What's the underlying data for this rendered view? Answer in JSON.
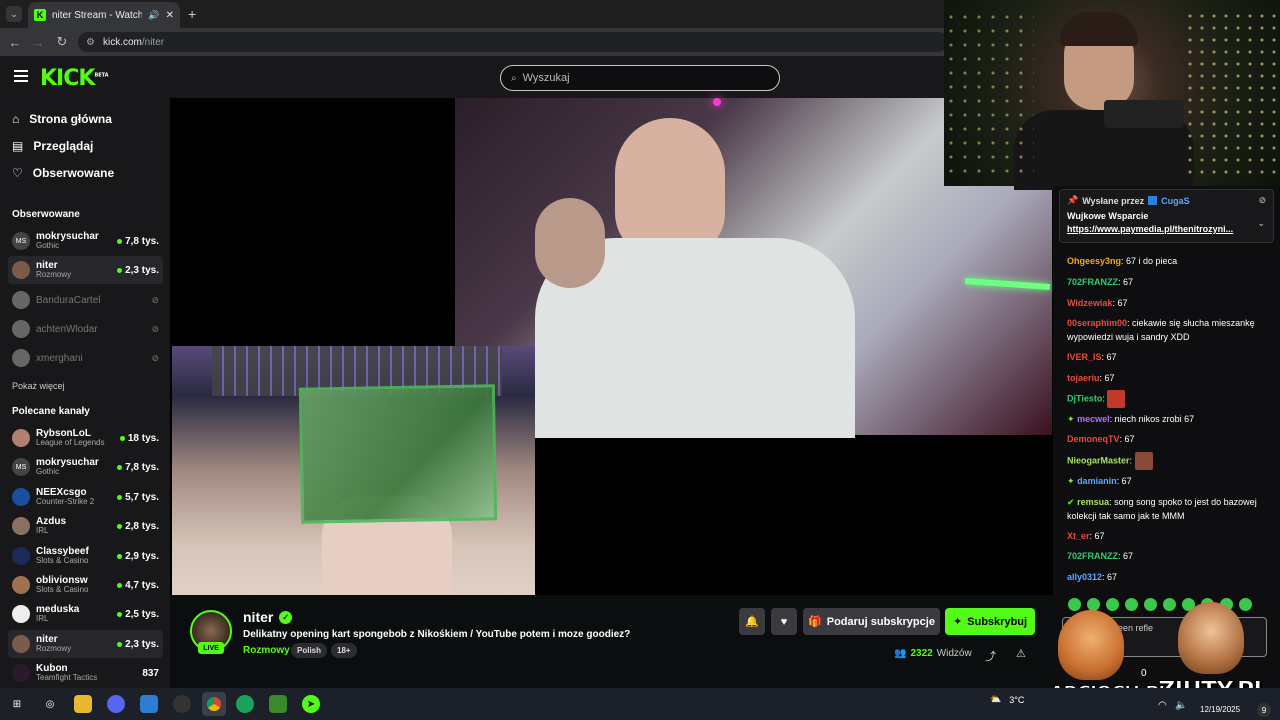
{
  "browser": {
    "tab_title": "niter Stream - Watch Live on Kick",
    "url": "kick.com/niter",
    "url_host": "kick.com",
    "url_path": "/niter"
  },
  "header": {
    "logo": "KICK",
    "logo_beta": "BETA",
    "search_placeholder": "Wyszukaj"
  },
  "sidebar": {
    "nav": [
      {
        "label": "Strona główna",
        "icon": "home-icon"
      },
      {
        "label": "Przeglądaj",
        "icon": "browse-icon"
      },
      {
        "label": "Obserwowane",
        "icon": "heart-icon"
      }
    ],
    "following_header": "Obserwowane",
    "following": [
      {
        "name": "mokrysuchar",
        "category": "Gothic",
        "viewers": "7,8 tys.",
        "live": true
      },
      {
        "name": "niter",
        "category": "Rozmowy",
        "viewers": "2,3 tys.",
        "live": true
      },
      {
        "name": "BanduraCartel",
        "live": false
      },
      {
        "name": "achtenWlodar",
        "live": false
      },
      {
        "name": "xmerghani",
        "live": false
      }
    ],
    "show_more": "Pokaż więcej",
    "recommended_header": "Polecane kanały",
    "recommended": [
      {
        "name": "RybsonLoL",
        "category": "League of Legends",
        "viewers": "18 tys."
      },
      {
        "name": "mokrysuchar",
        "category": "Gothic",
        "viewers": "7,8 tys."
      },
      {
        "name": "NEEXcsgo",
        "category": "Counter-Strike 2",
        "viewers": "5,7 tys."
      },
      {
        "name": "Azdus",
        "category": "IRL",
        "viewers": "2,8 tys."
      },
      {
        "name": "Classybeef",
        "category": "Slots & Casino",
        "viewers": "2,9 tys."
      },
      {
        "name": "oblivionsw",
        "category": "Slots & Casino",
        "viewers": "4,7 tys."
      },
      {
        "name": "meduska",
        "category": "IRL",
        "viewers": "2,5 tys."
      },
      {
        "name": "niter",
        "category": "Rozmowy",
        "viewers": "2,3 tys."
      },
      {
        "name": "Kubon",
        "category": "Teamfight Tactics",
        "viewers": "837"
      }
    ]
  },
  "stream": {
    "channel": "niter",
    "live_label": "LIVE",
    "title": "Delikatny opening kart spongebob z Nikośkiem / YouTube potem i moze goodiez?",
    "category": "Rozmowy",
    "tags": [
      "Polish",
      "18+"
    ],
    "gift_label": "Podaruj subskrypcje",
    "subscribe_label": "Subskrybuj",
    "viewers": "2322",
    "viewers_label": "Widzów"
  },
  "chat": {
    "pinned": {
      "sent_by_label": "Wysłane przez",
      "sent_by": "CugaS",
      "line1": "Wujkowe Wsparcie",
      "line2": "https://www.paymedia.pl/thenitrozyni..."
    },
    "messages": [
      {
        "user": "Ohgeesy3ng",
        "color": "#f5a623",
        "text": ": 67 i do pieca"
      },
      {
        "user": "702FRANZZ",
        "color": "#2ecc71",
        "text": ": 67"
      },
      {
        "user": "Widzewiak",
        "color": "#e74c3c",
        "text": ": 67"
      },
      {
        "user": "00seraphim00",
        "color": "#e74c3c",
        "text": ": ciekawie się słucha mieszankę wypowiedzi wuja i sandry XDD"
      },
      {
        "user": "IVER_IS",
        "color": "#e74c3c",
        "text": ": 67"
      },
      {
        "user": "tojaeriu",
        "color": "#e74c3c",
        "text": ": 67"
      },
      {
        "user": "DjTiesto",
        "color": "#2ecc71",
        "text": ":"
      },
      {
        "user": "mecwel",
        "color": "#b56cff",
        "text": ": niech nikos zrobi 67"
      },
      {
        "user": "DemoneqTV",
        "color": "#e74c3c",
        "text": ": 67"
      },
      {
        "user": "NieogarMaster",
        "color": "#a8e063",
        "text": ":"
      },
      {
        "user": "damianin",
        "color": "#5aa7ff",
        "text": ": 67"
      },
      {
        "user": "remsua",
        "color": "#a8e063",
        "text": ": song song spoko to jest do bazowej kolekcji tak samo jak te MMM"
      },
      {
        "user": "Xt_er",
        "color": "#e74c3c",
        "text": ": 67"
      },
      {
        "user": "702FRANZZ",
        "color": "#2ecc71",
        "text": ": 67"
      },
      {
        "user": "ally0312",
        "color": "#5aa7ff",
        "text": ": 67"
      }
    ],
    "input_partial": "een refle",
    "count": "0"
  },
  "overlays": {
    "promo1": "KARCIOCH.PL",
    "promo2": "ZIUTY.PL"
  },
  "taskbar": {
    "temperature": "3°C",
    "date": "12/19/2025",
    "notif_count": "9"
  },
  "colors": {
    "kick_green": "#53fc18",
    "sidebar_bg": "#18181b",
    "page_bg": "#0b0e0f"
  }
}
